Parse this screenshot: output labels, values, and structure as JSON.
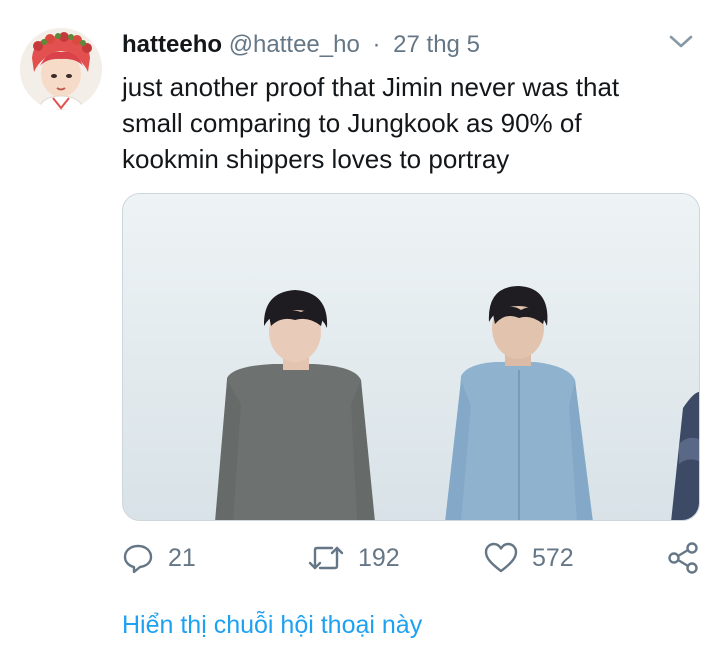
{
  "author": {
    "name": "hatteeho",
    "handle": "@hattee_ho",
    "separator": "·",
    "date": "27 thg 5"
  },
  "tweet": {
    "line1": "just another proof that Jimin never was that",
    "line2": "small comparing to Jungkook as 90% of",
    "line3": "kookmin shippers loves to portray"
  },
  "actions": {
    "reply_count": "21",
    "retweet_count": "192",
    "like_count": "572"
  },
  "thread_link": "Hiển thị chuỗi hội thoại này",
  "icons": {
    "avatar": "avatar-illustration",
    "caret": "chevron-down-icon",
    "reply": "reply-icon",
    "retweet": "retweet-icon",
    "like": "heart-icon",
    "share": "share-icon"
  },
  "colors": {
    "text": "#14171a",
    "secondary": "#657786",
    "link": "#1da1f2",
    "media_border": "#ccd6dd"
  }
}
